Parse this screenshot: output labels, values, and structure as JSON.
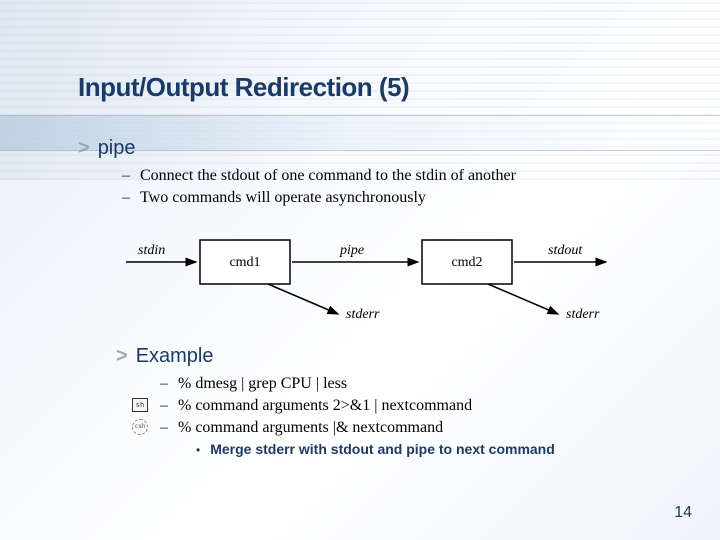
{
  "title": "Input/Output Redirection (5)",
  "section1": {
    "chevron": ">",
    "heading": "pipe",
    "bullets": [
      "Connect the stdout of one command to the stdin of another",
      "Two commands will operate asynchronously"
    ]
  },
  "diagram": {
    "stdin_label": "stdin",
    "cmd1_label": "cmd1",
    "pipe_label": "pipe",
    "cmd2_label": "cmd2",
    "stdout_label": "stdout",
    "stderr_label": "stderr"
  },
  "section2": {
    "chevron": ">",
    "heading": "Example",
    "examples": [
      "% dmesg | grep CPU | less",
      "% command arguments 2>&1 | nextcommand",
      "% command arguments |& nextcommand"
    ],
    "nested": "Merge stderr with stdout and pipe to next command"
  },
  "icons": {
    "sh": "sh",
    "csh": "csh"
  },
  "page_number": "14"
}
